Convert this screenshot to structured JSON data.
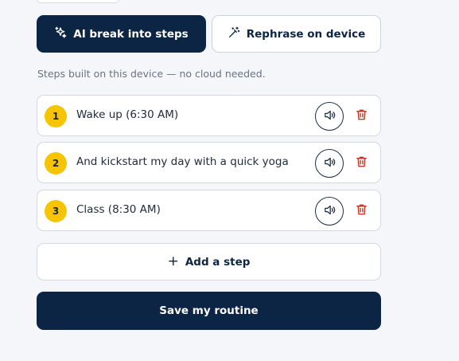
{
  "actions": {
    "ai_break_label": "AI break into steps",
    "rephrase_label": "Rephrase on device"
  },
  "hint": "Steps built on this device — no cloud needed.",
  "steps": [
    {
      "number": "1",
      "label": "Wake up (6:30 AM)"
    },
    {
      "number": "2",
      "label": "And kickstart my day with a quick yoga"
    },
    {
      "number": "3",
      "label": "Class (8:30 AM)"
    }
  ],
  "add_step_label": "Add a step",
  "add_step_icon": "+",
  "save_label": "Save my routine",
  "icons": {
    "sparkles": "sparkles-icon",
    "wand": "magic-wand-icon",
    "speaker": "speaker-icon",
    "trash": "trash-icon"
  },
  "colors": {
    "primary": "#0c2545",
    "badge": "#f6c400",
    "danger": "#c0392b",
    "background": "#f4f6f9"
  }
}
